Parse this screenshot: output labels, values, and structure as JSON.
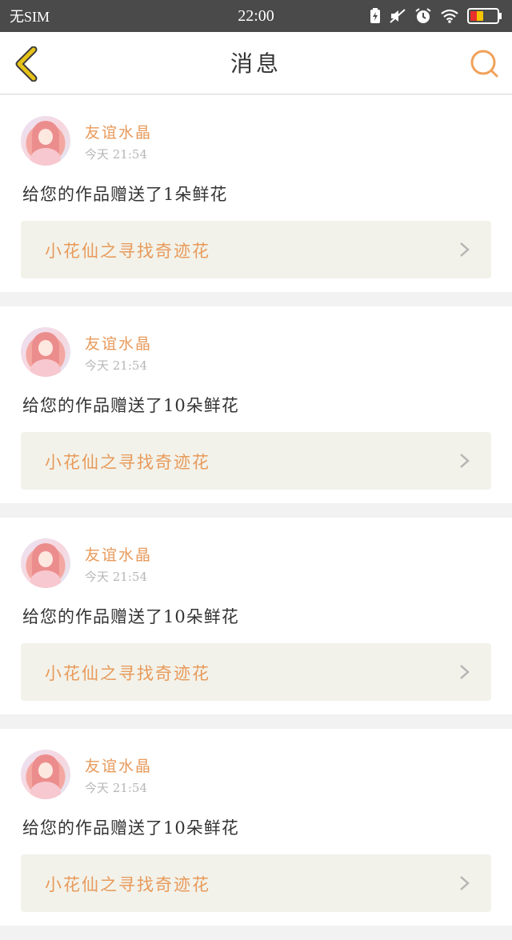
{
  "status_bar": {
    "carrier": "无SIM",
    "time": "22:00",
    "icons": [
      "battery-saver-icon",
      "mute-icon",
      "alarm-icon",
      "wifi-icon",
      "battery-icon"
    ]
  },
  "header": {
    "title": "消息",
    "back_icon": "back-arrow-icon",
    "search_icon": "search-icon"
  },
  "colors": {
    "accent": "#e89a5b",
    "back_icon": "#e6c21a",
    "battery_low": "#e8322a",
    "battery_mid": "#f5c400"
  },
  "messages": [
    {
      "user": "友谊水晶",
      "time": "今天 21:54",
      "text": "给您的作品赠送了1朵鲜花",
      "work": "小花仙之寻找奇迹花"
    },
    {
      "user": "友谊水晶",
      "time": "今天 21:54",
      "text": "给您的作品赠送了10朵鲜花",
      "work": "小花仙之寻找奇迹花"
    },
    {
      "user": "友谊水晶",
      "time": "今天 21:54",
      "text": "给您的作品赠送了10朵鲜花",
      "work": "小花仙之寻找奇迹花"
    },
    {
      "user": "友谊水晶",
      "time": "今天 21:54",
      "text": "给您的作品赠送了10朵鲜花",
      "work": "小花仙之寻找奇迹花"
    }
  ]
}
